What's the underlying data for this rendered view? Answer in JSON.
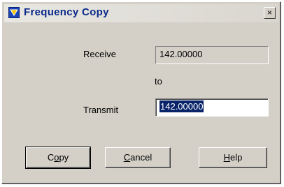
{
  "window": {
    "title": "Frequency Copy",
    "close_label": "×"
  },
  "form": {
    "receive_label": "Receive",
    "receive_value": "142.00000",
    "to_label": "to",
    "transmit_label": "Transmit",
    "transmit_value": "142.00000"
  },
  "buttons": {
    "copy": {
      "pre": "C",
      "mnemonic": "o",
      "post": "py"
    },
    "cancel": {
      "pre": "",
      "mnemonic": "C",
      "post": "ancel"
    },
    "help": {
      "pre": "",
      "mnemonic": "H",
      "post": "elp"
    }
  },
  "colors": {
    "face": "#d4d0c8",
    "title_text": "#0a2a8a",
    "selection": "#0a246a"
  },
  "icons": {
    "title": "app-triangle-icon",
    "close": "close-icon"
  }
}
